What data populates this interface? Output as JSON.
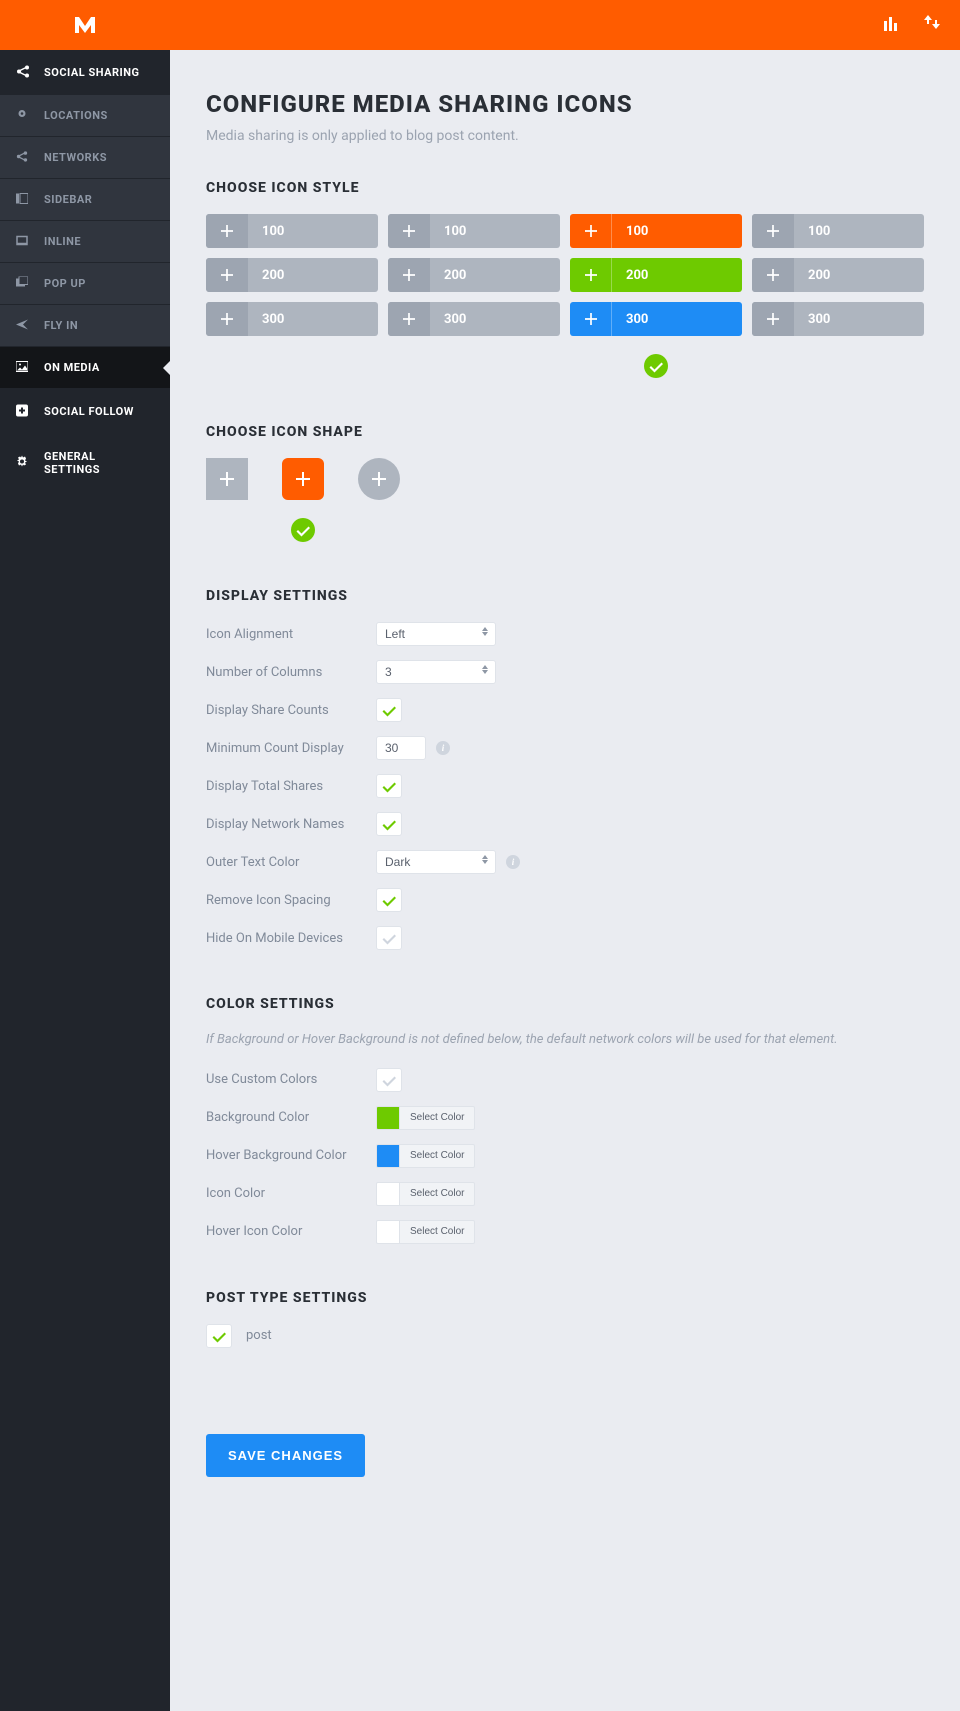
{
  "sidebar": {
    "group_title": "SOCIAL SHARING",
    "items": [
      {
        "label": "LOCATIONS"
      },
      {
        "label": "NETWORKS"
      },
      {
        "label": "SIDEBAR"
      },
      {
        "label": "INLINE"
      },
      {
        "label": "POP UP"
      },
      {
        "label": "FLY IN"
      },
      {
        "label": "ON MEDIA"
      }
    ],
    "standalone": [
      {
        "label": "SOCIAL FOLLOW"
      },
      {
        "label": "GENERAL SETTINGS"
      }
    ]
  },
  "page": {
    "title": "CONFIGURE MEDIA SHARING ICONS",
    "subtitle": "Media sharing is only applied to blog post content."
  },
  "sections": {
    "style": {
      "title": "CHOOSE ICON STYLE",
      "labels": [
        "100",
        "200",
        "300",
        "100",
        "200",
        "300",
        "100",
        "200",
        "300",
        "100",
        "200",
        "300"
      ]
    },
    "shape": {
      "title": "CHOOSE ICON SHAPE"
    },
    "display": {
      "title": "DISPLAY SETTINGS",
      "rows": {
        "icon_alignment": {
          "label": "Icon Alignment",
          "value": "Left"
        },
        "num_columns": {
          "label": "Number of Columns",
          "value": "3"
        },
        "share_counts": {
          "label": "Display Share Counts"
        },
        "min_count": {
          "label": "Minimum Count Display",
          "value": "30"
        },
        "total_shares": {
          "label": "Display Total Shares"
        },
        "network_names": {
          "label": "Display Network Names"
        },
        "outer_text": {
          "label": "Outer Text Color",
          "value": "Dark"
        },
        "remove_spacing": {
          "label": "Remove Icon Spacing"
        },
        "hide_mobile": {
          "label": "Hide On Mobile Devices"
        }
      }
    },
    "color": {
      "title": "COLOR SETTINGS",
      "note": "If Background or Hover Background is not defined below, the default network colors will be used for that element.",
      "rows": {
        "custom": {
          "label": "Use Custom Colors"
        },
        "bg": {
          "label": "Background Color"
        },
        "hover_bg": {
          "label": "Hover Background Color"
        },
        "icon": {
          "label": "Icon Color"
        },
        "hover_icon": {
          "label": "Hover Icon Color"
        }
      },
      "select_color": "Select Color"
    },
    "posttype": {
      "title": "POST TYPE SETTINGS",
      "post_label": "post"
    }
  },
  "buttons": {
    "save": "SAVE CHANGES"
  }
}
